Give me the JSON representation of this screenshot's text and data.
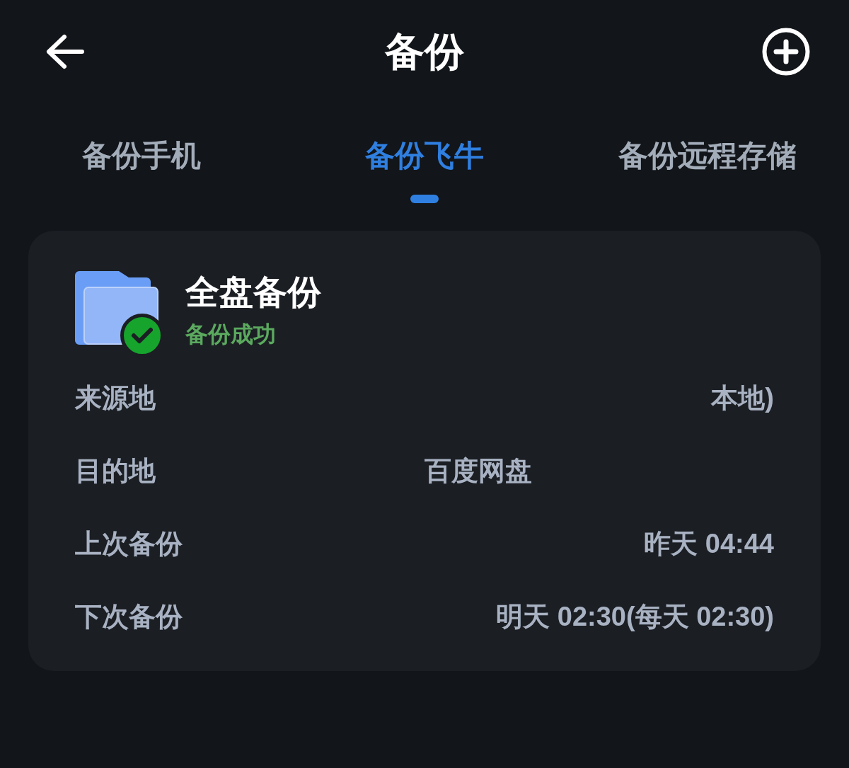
{
  "header": {
    "title": "备份"
  },
  "tabs": [
    {
      "label": "备份手机",
      "selected": false
    },
    {
      "label": "备份飞牛",
      "selected": true
    },
    {
      "label": "备份远程存储",
      "selected": false
    }
  ],
  "task": {
    "title": "全盘备份",
    "status": {
      "text": "备份成功",
      "kind": "success"
    },
    "rows": [
      {
        "label": "来源地",
        "value": "本地)",
        "kind": "end"
      },
      {
        "label": "目的地",
        "value": "百度网盘",
        "kind": "start"
      },
      {
        "label": "上次备份",
        "value": "昨天 04:44",
        "kind": "end"
      },
      {
        "label": "下次备份",
        "value": "明天 02:30(每天 02:30)",
        "kind": "end"
      }
    ]
  }
}
